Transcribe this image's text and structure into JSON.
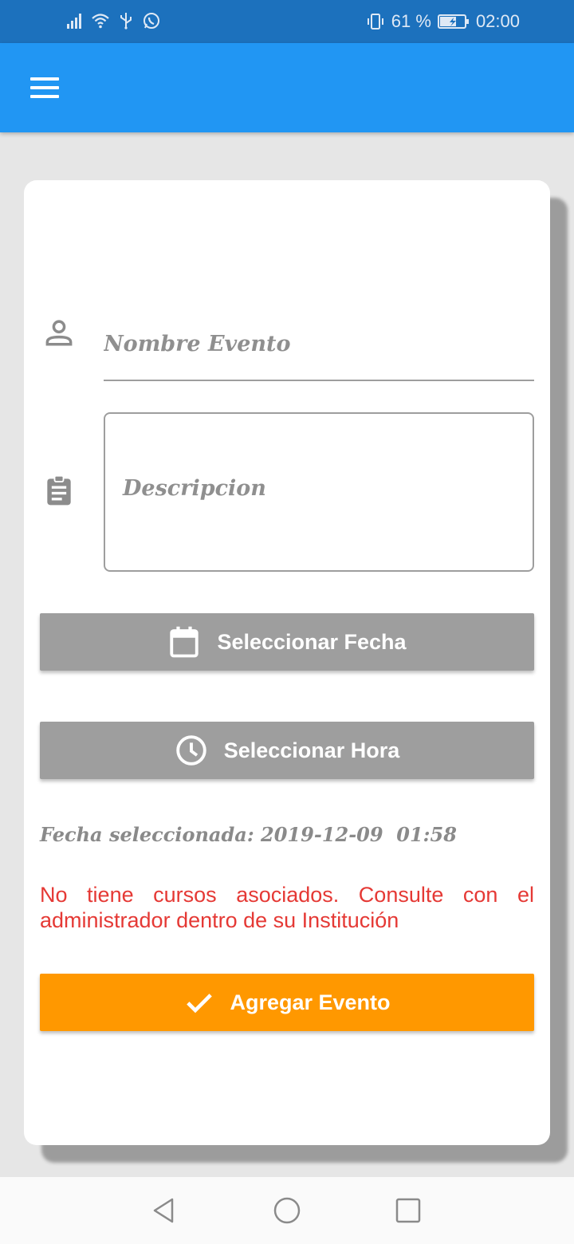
{
  "status_bar": {
    "battery": "61 %",
    "time": "02:00",
    "icons": [
      "signal-icon",
      "wifi-icon",
      "usb-icon",
      "whatsapp-icon",
      "vibrate-icon",
      "battery-charging-icon"
    ]
  },
  "app_bar": {
    "menu_icon": "hamburger-menu-icon"
  },
  "form": {
    "name_placeholder": "Nombre Evento",
    "description_placeholder": "Descripcion",
    "select_date_label": "Seleccionar Fecha",
    "select_time_label": "Seleccionar Hora",
    "selected_date_text": "Fecha seleccionada: 2019-12-09  01:58",
    "error_message": "No tiene cursos asociados. Consulte con el administrador dentro de su Institución",
    "add_event_label": "Agregar Evento"
  },
  "colors": {
    "status_bar": "#1c71bd",
    "app_bar": "#2196f3",
    "gray_button": "#9e9e9e",
    "accent_button": "#ff9800",
    "error_text": "#e53935"
  },
  "nav_bar": {
    "icons": [
      "back-icon",
      "home-icon",
      "recents-icon"
    ]
  }
}
